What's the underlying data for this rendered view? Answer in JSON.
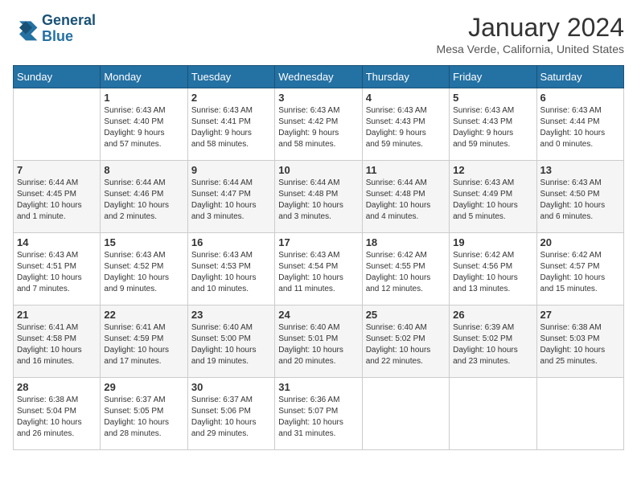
{
  "header": {
    "logo_line1": "General",
    "logo_line2": "Blue",
    "month_year": "January 2024",
    "location": "Mesa Verde, California, United States"
  },
  "calendar": {
    "days_of_week": [
      "Sunday",
      "Monday",
      "Tuesday",
      "Wednesday",
      "Thursday",
      "Friday",
      "Saturday"
    ],
    "weeks": [
      [
        {
          "day": "",
          "info": ""
        },
        {
          "day": "1",
          "info": "Sunrise: 6:43 AM\nSunset: 4:40 PM\nDaylight: 9 hours\nand 57 minutes."
        },
        {
          "day": "2",
          "info": "Sunrise: 6:43 AM\nSunset: 4:41 PM\nDaylight: 9 hours\nand 58 minutes."
        },
        {
          "day": "3",
          "info": "Sunrise: 6:43 AM\nSunset: 4:42 PM\nDaylight: 9 hours\nand 58 minutes."
        },
        {
          "day": "4",
          "info": "Sunrise: 6:43 AM\nSunset: 4:43 PM\nDaylight: 9 hours\nand 59 minutes."
        },
        {
          "day": "5",
          "info": "Sunrise: 6:43 AM\nSunset: 4:43 PM\nDaylight: 9 hours\nand 59 minutes."
        },
        {
          "day": "6",
          "info": "Sunrise: 6:43 AM\nSunset: 4:44 PM\nDaylight: 10 hours\nand 0 minutes."
        }
      ],
      [
        {
          "day": "7",
          "info": "Sunrise: 6:44 AM\nSunset: 4:45 PM\nDaylight: 10 hours\nand 1 minute."
        },
        {
          "day": "8",
          "info": "Sunrise: 6:44 AM\nSunset: 4:46 PM\nDaylight: 10 hours\nand 2 minutes."
        },
        {
          "day": "9",
          "info": "Sunrise: 6:44 AM\nSunset: 4:47 PM\nDaylight: 10 hours\nand 3 minutes."
        },
        {
          "day": "10",
          "info": "Sunrise: 6:44 AM\nSunset: 4:48 PM\nDaylight: 10 hours\nand 3 minutes."
        },
        {
          "day": "11",
          "info": "Sunrise: 6:44 AM\nSunset: 4:48 PM\nDaylight: 10 hours\nand 4 minutes."
        },
        {
          "day": "12",
          "info": "Sunrise: 6:43 AM\nSunset: 4:49 PM\nDaylight: 10 hours\nand 5 minutes."
        },
        {
          "day": "13",
          "info": "Sunrise: 6:43 AM\nSunset: 4:50 PM\nDaylight: 10 hours\nand 6 minutes."
        }
      ],
      [
        {
          "day": "14",
          "info": "Sunrise: 6:43 AM\nSunset: 4:51 PM\nDaylight: 10 hours\nand 7 minutes."
        },
        {
          "day": "15",
          "info": "Sunrise: 6:43 AM\nSunset: 4:52 PM\nDaylight: 10 hours\nand 9 minutes."
        },
        {
          "day": "16",
          "info": "Sunrise: 6:43 AM\nSunset: 4:53 PM\nDaylight: 10 hours\nand 10 minutes."
        },
        {
          "day": "17",
          "info": "Sunrise: 6:43 AM\nSunset: 4:54 PM\nDaylight: 10 hours\nand 11 minutes."
        },
        {
          "day": "18",
          "info": "Sunrise: 6:42 AM\nSunset: 4:55 PM\nDaylight: 10 hours\nand 12 minutes."
        },
        {
          "day": "19",
          "info": "Sunrise: 6:42 AM\nSunset: 4:56 PM\nDaylight: 10 hours\nand 13 minutes."
        },
        {
          "day": "20",
          "info": "Sunrise: 6:42 AM\nSunset: 4:57 PM\nDaylight: 10 hours\nand 15 minutes."
        }
      ],
      [
        {
          "day": "21",
          "info": "Sunrise: 6:41 AM\nSunset: 4:58 PM\nDaylight: 10 hours\nand 16 minutes."
        },
        {
          "day": "22",
          "info": "Sunrise: 6:41 AM\nSunset: 4:59 PM\nDaylight: 10 hours\nand 17 minutes."
        },
        {
          "day": "23",
          "info": "Sunrise: 6:40 AM\nSunset: 5:00 PM\nDaylight: 10 hours\nand 19 minutes."
        },
        {
          "day": "24",
          "info": "Sunrise: 6:40 AM\nSunset: 5:01 PM\nDaylight: 10 hours\nand 20 minutes."
        },
        {
          "day": "25",
          "info": "Sunrise: 6:40 AM\nSunset: 5:02 PM\nDaylight: 10 hours\nand 22 minutes."
        },
        {
          "day": "26",
          "info": "Sunrise: 6:39 AM\nSunset: 5:02 PM\nDaylight: 10 hours\nand 23 minutes."
        },
        {
          "day": "27",
          "info": "Sunrise: 6:38 AM\nSunset: 5:03 PM\nDaylight: 10 hours\nand 25 minutes."
        }
      ],
      [
        {
          "day": "28",
          "info": "Sunrise: 6:38 AM\nSunset: 5:04 PM\nDaylight: 10 hours\nand 26 minutes."
        },
        {
          "day": "29",
          "info": "Sunrise: 6:37 AM\nSunset: 5:05 PM\nDaylight: 10 hours\nand 28 minutes."
        },
        {
          "day": "30",
          "info": "Sunrise: 6:37 AM\nSunset: 5:06 PM\nDaylight: 10 hours\nand 29 minutes."
        },
        {
          "day": "31",
          "info": "Sunrise: 6:36 AM\nSunset: 5:07 PM\nDaylight: 10 hours\nand 31 minutes."
        },
        {
          "day": "",
          "info": ""
        },
        {
          "day": "",
          "info": ""
        },
        {
          "day": "",
          "info": ""
        }
      ]
    ]
  }
}
